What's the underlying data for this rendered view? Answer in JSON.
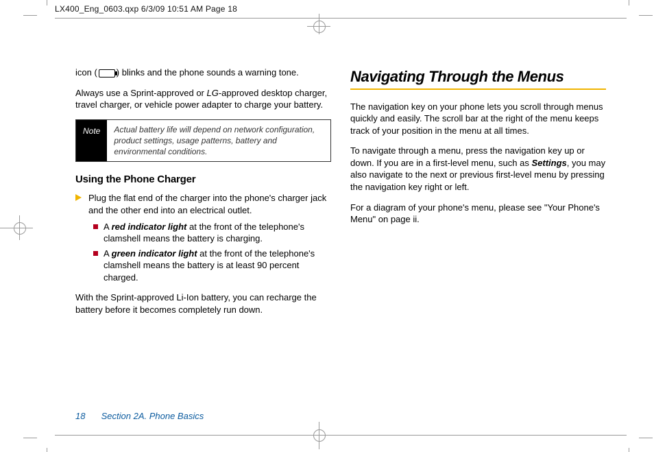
{
  "slug": "LX400_Eng_0603.qxp  6/3/09  10:51 AM  Page 18",
  "left": {
    "p1a": "icon (",
    "p1b": ") blinks and the phone sounds a warning tone.",
    "p2": "Always use a Sprint-approved or LG-approved desktop charger, travel charger, or vehicle power adapter to charge your battery.",
    "note_label": "Note",
    "note_text": "Actual battery life will depend on network configuration, product settings, usage patterns, battery and environmental conditions.",
    "h3": "Using the Phone Charger",
    "step1": "Plug the flat end of the charger into the phone's charger jack and the other end into an electrical outlet.",
    "b1a": "A ",
    "b1b": "red indicator light",
    "b1c": " at the front of the telephone's clamshell means the battery is charging.",
    "b2a": "A ",
    "b2b": "green indicator light",
    "b2c": " at the front of the telephone's clamshell means the battery is at least 90 percent charged.",
    "p3": "With the Sprint-approved Li-Ion battery, you can recharge the battery before it becomes completely run down."
  },
  "right": {
    "title": "Navigating Through the Menus",
    "p1": "The navigation key on your phone lets you scroll through menus quickly and easily. The scroll bar at the right of the menu keeps track of your position in the menu at all times.",
    "p2a": "To navigate through a menu, press the navigation key up or down. If you are in a first-level menu, such as ",
    "p2b": "Settings",
    "p2c": ", you may also navigate to the next or previous first-level menu by pressing the navigation key right or left.",
    "p3": "For a diagram of your phone's menu, please see \"Your Phone's Menu\" on page ii."
  },
  "footer": {
    "page": "18",
    "section": "Section 2A. Phone Basics"
  }
}
